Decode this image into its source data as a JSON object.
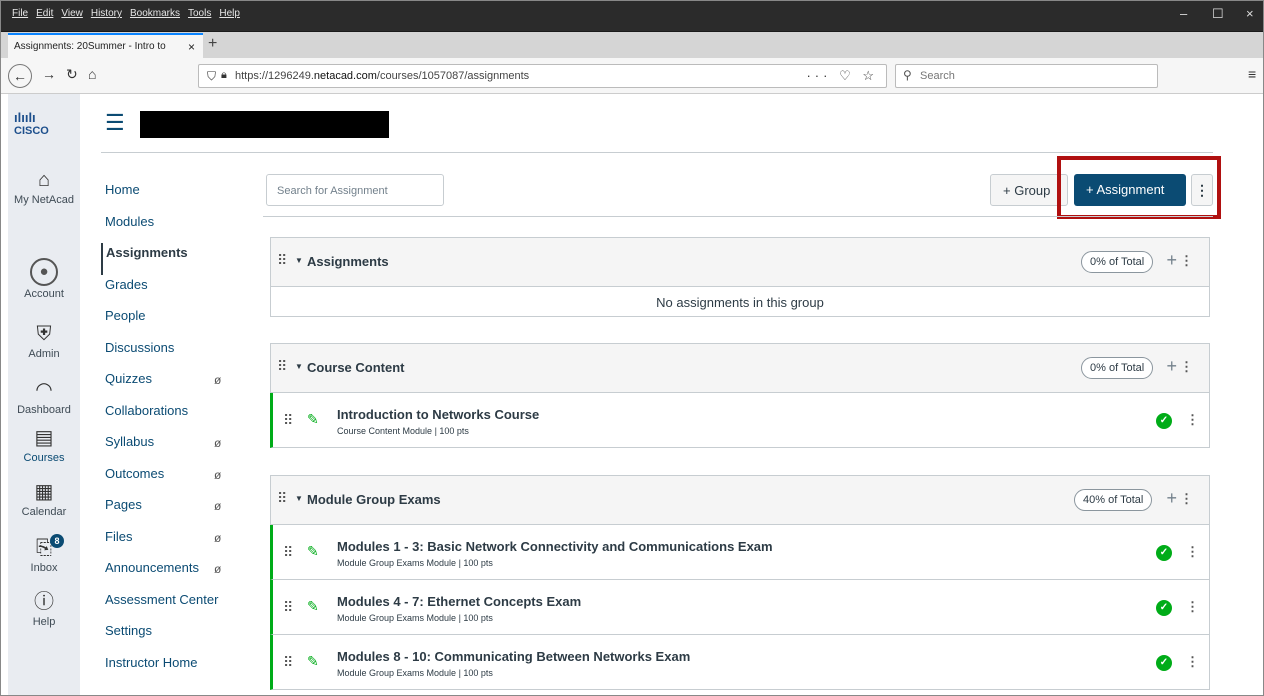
{
  "browser": {
    "menu": [
      "File",
      "Edit",
      "View",
      "History",
      "Bookmarks",
      "Tools",
      "Help"
    ],
    "tab_title": "Assignments: 20Summer - Intro to",
    "tab_close": "×",
    "new_tab": "+",
    "url_prefix": "https://1296249.",
    "url_domain": "netacad.com",
    "url_suffix": "/courses/1057087/assignments",
    "url_actions": "··· ♡ ☆",
    "search_placeholder": "Search",
    "win_minimize": "–",
    "win_maximize": "☐",
    "win_close": "×"
  },
  "logo": {
    "bars": "ılıılı",
    "text": "CISCO"
  },
  "global_nav": [
    {
      "label": "My NetAcad",
      "icon": "house-icon"
    },
    {
      "label": "Account",
      "icon": "user-avatar-icon"
    },
    {
      "label": "Admin",
      "icon": "admin-shield-icon"
    },
    {
      "label": "Dashboard",
      "icon": "dashboard-gauge-icon"
    },
    {
      "label": "Courses",
      "icon": "courses-book-icon"
    },
    {
      "label": "Calendar",
      "icon": "calendar-icon"
    },
    {
      "label": "Inbox",
      "icon": "inbox-icon",
      "badge": "8"
    },
    {
      "label": "Help",
      "icon": "help-question-icon"
    }
  ],
  "course_nav": [
    {
      "label": "Home"
    },
    {
      "label": "Modules"
    },
    {
      "label": "Assignments",
      "active": true
    },
    {
      "label": "Grades"
    },
    {
      "label": "People"
    },
    {
      "label": "Discussions"
    },
    {
      "label": "Quizzes",
      "hidden": true
    },
    {
      "label": "Collaborations"
    },
    {
      "label": "Syllabus",
      "hidden": true
    },
    {
      "label": "Outcomes",
      "hidden": true
    },
    {
      "label": "Pages",
      "hidden": true
    },
    {
      "label": "Files",
      "hidden": true
    },
    {
      "label": "Announcements",
      "hidden": true
    },
    {
      "label": "Assessment Center"
    },
    {
      "label": "Settings"
    },
    {
      "label": "Instructor Home"
    }
  ],
  "toolbar": {
    "search_placeholder": "Search for Assignment",
    "group_button": "+ Group",
    "assignment_button": "+ Assignment",
    "kebab": "⋮"
  },
  "groups": [
    {
      "name": "Assignments",
      "weight": "0% of Total",
      "empty_text": "No assignments in this group",
      "items": []
    },
    {
      "name": "Course Content",
      "weight": "0% of Total",
      "items": [
        {
          "title": "Introduction to Networks Course",
          "module": "Course Content Module",
          "points": "100 pts"
        }
      ]
    },
    {
      "name": "Module Group Exams",
      "weight": "40% of Total",
      "items": [
        {
          "title": "Modules 1 - 3: Basic Network Connectivity and Communications Exam",
          "module": "Module Group Exams Module",
          "points": "100 pts"
        },
        {
          "title": "Modules 4 - 7: Ethernet Concepts Exam",
          "module": "Module Group Exams Module",
          "points": "100 pts"
        },
        {
          "title": "Modules 8 - 10: Communicating Between Networks Exam",
          "module": "Module Group Exams Module",
          "points": "100 pts"
        }
      ]
    }
  ],
  "colors": {
    "accent": "#0b4b73",
    "published": "#00ac18",
    "highlight": "#b01010"
  }
}
